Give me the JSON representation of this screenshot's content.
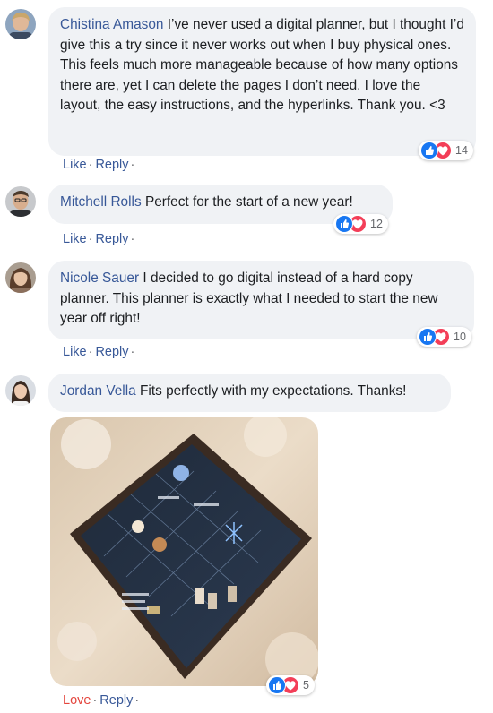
{
  "comments": [
    {
      "author": "Chistina Amason",
      "text": "I’ve never used a digital planner, but I thought I’d give this a try since it never works out when I buy physical ones. This feels much more manageable because of how many options there are, yet I can delete the pages I don’t need. I love the layout, the easy instructions, and the hyperlinks. Thank you. <3",
      "reactions_count": "14",
      "actions": [
        "Like",
        "Reply"
      ]
    },
    {
      "author": "Mitchell Rolls",
      "text": "Perfect for the start of a new year!",
      "reactions_count": "12",
      "actions": [
        "Like",
        "Reply"
      ]
    },
    {
      "author": "Nicole Sauer",
      "text": "I decided to go digital instead of a hard copy planner. This planner is exactly what I needed to start the new year off right!",
      "reactions_count": "10",
      "actions": [
        "Like",
        "Reply"
      ]
    },
    {
      "author": "Jordan Vella",
      "text": "Fits perfectly with my expectations. Thanks!",
      "reactions_count": "5",
      "actions": [
        "Love",
        "Reply"
      ]
    }
  ],
  "separator": "·",
  "colors": {
    "author_link": "#385898",
    "bubble_bg": "#f0f2f5",
    "like_blue": "#1877f2",
    "love_red": "#f33e58",
    "love_text": "#e4453d"
  }
}
